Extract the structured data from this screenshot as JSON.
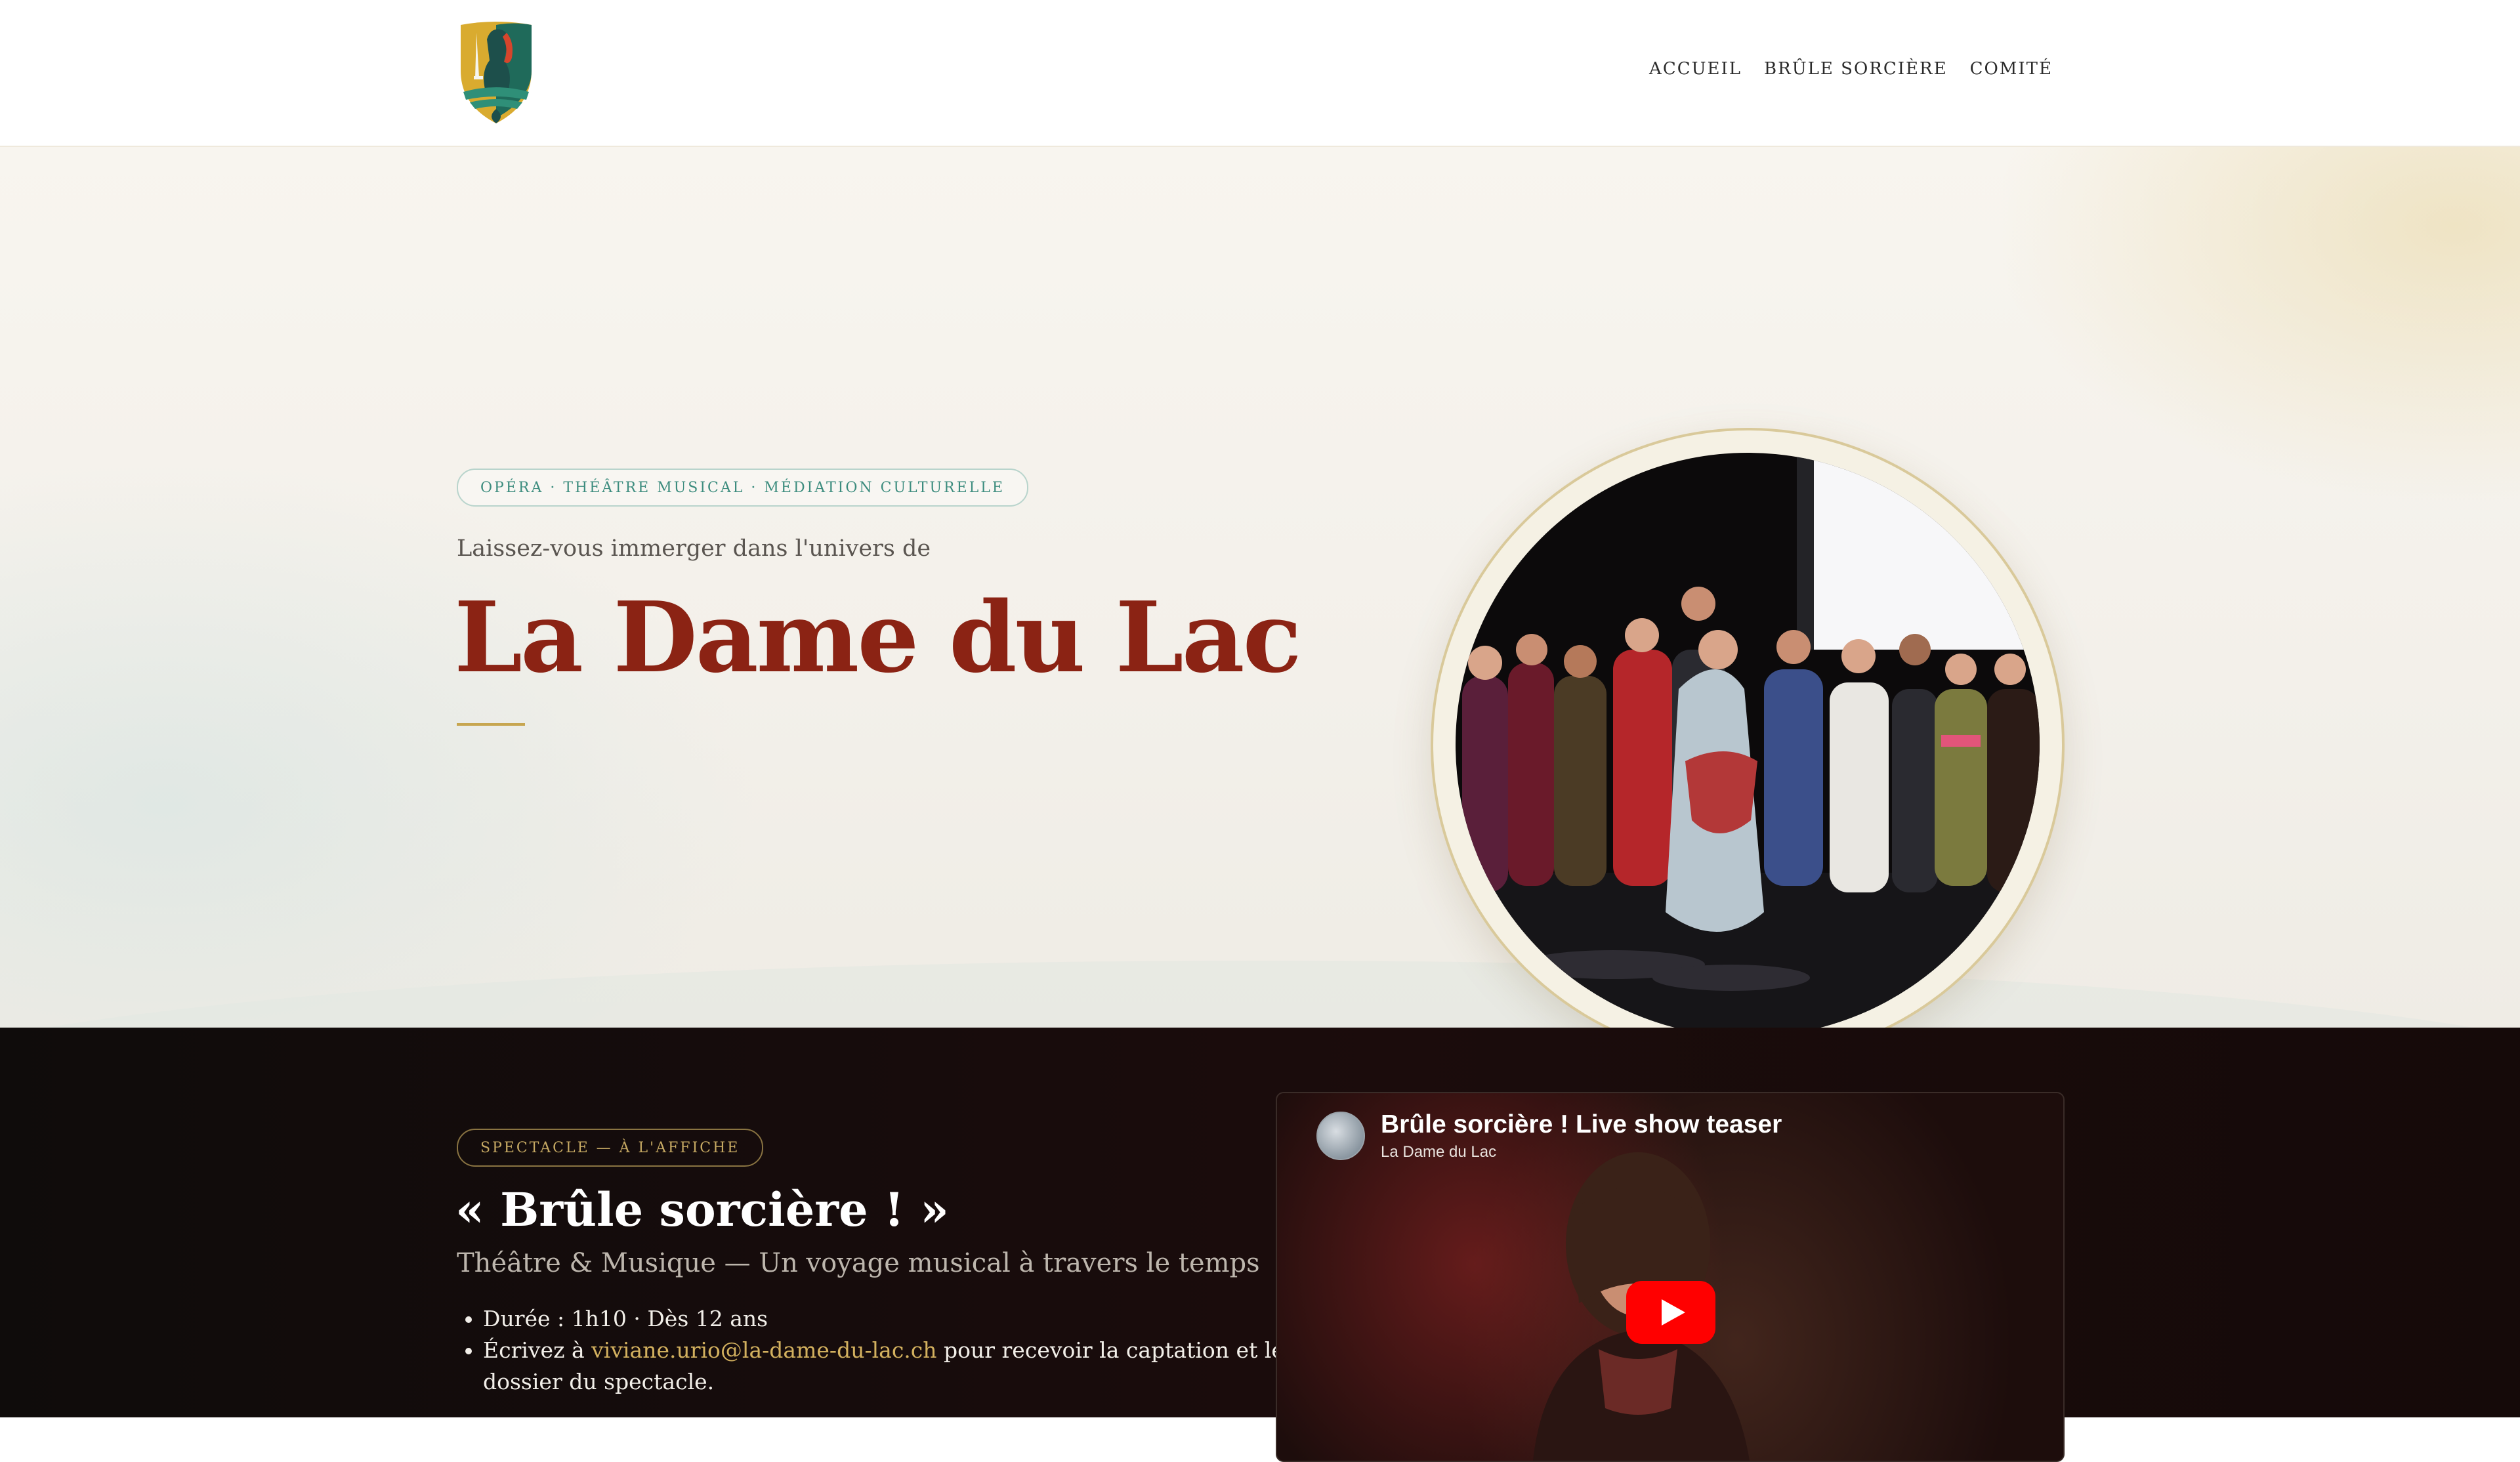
{
  "nav": {
    "items": [
      {
        "label": "ACCUEIL"
      },
      {
        "label": "BRÛLE SORCIÈRE"
      },
      {
        "label": "COMITÉ"
      }
    ]
  },
  "hero": {
    "badge": "OPÉRA · THÉÂTRE MUSICAL · MÉDIATION CULTURELLE",
    "intro": "Laissez-vous immerger dans l'univers de",
    "title": "La Dame du Lac"
  },
  "show": {
    "badge": "SPECTACLE — À L'AFFICHE",
    "title": "« Brûle sorcière ! »",
    "subtitle": "Théâtre & Musique — Un voyage musical à travers le temps",
    "details": {
      "duration": "Durée : 1h10 · Dès 12 ans",
      "contact_prefix": "Écrivez à ",
      "contact_email": "viviane.urio@la-dame-du-lac.ch",
      "contact_suffix": " pour recevoir la captation et le dossier du spectacle."
    }
  },
  "video": {
    "title": "Brûle sorcière ! Live show teaser",
    "channel": "La Dame du Lac"
  },
  "colors": {
    "accent_red": "#8b2314",
    "gold": "#c7a650",
    "teal": "#3c8c7e",
    "youtube_red": "#ff0000"
  }
}
